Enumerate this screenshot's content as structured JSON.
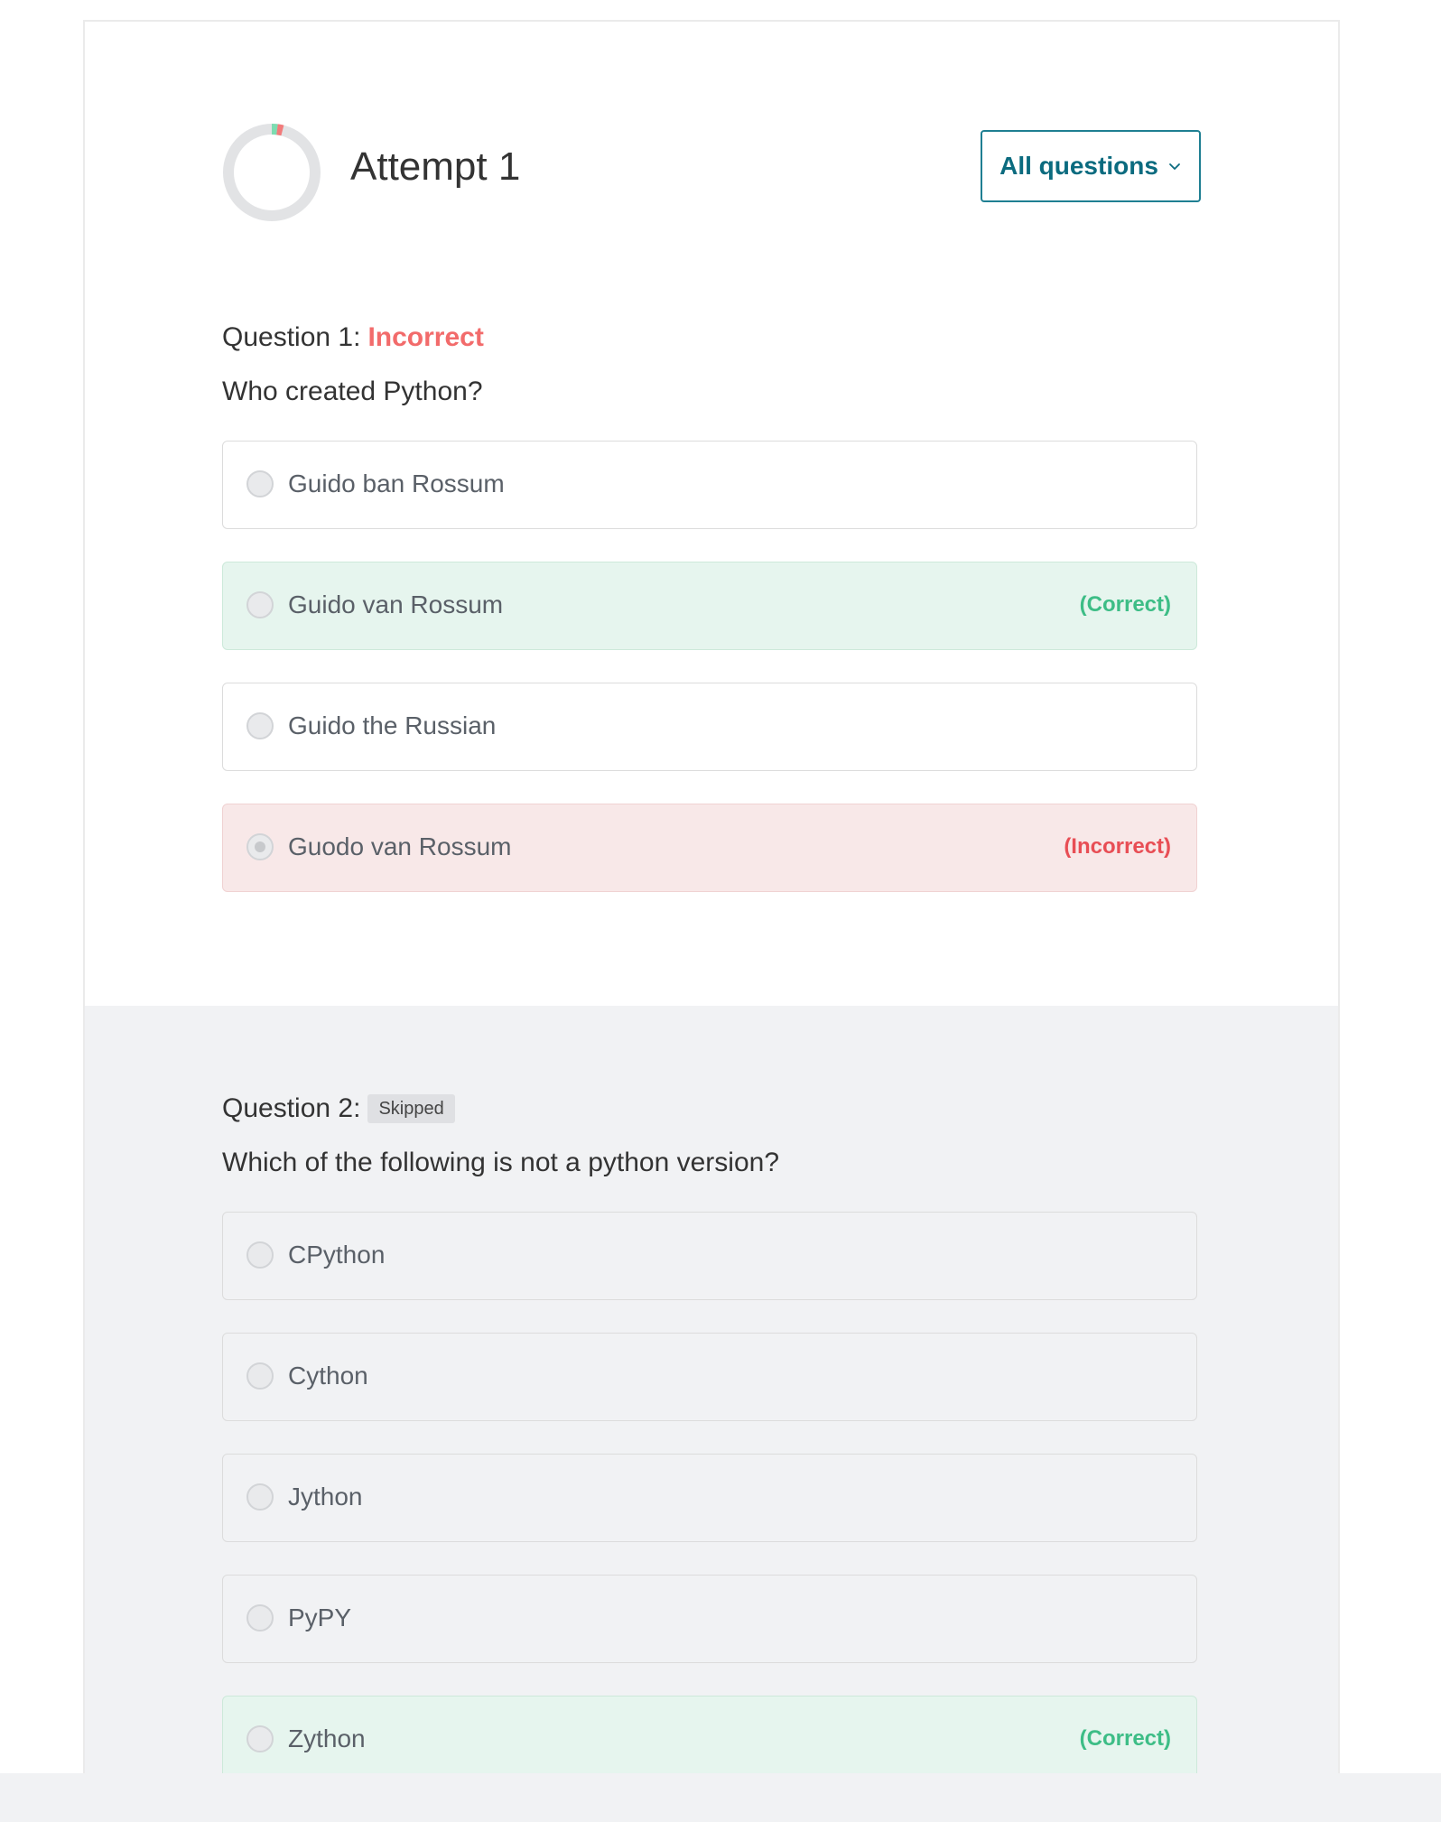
{
  "attempt": {
    "title": "Attempt 1",
    "all_questions_label": "All questions",
    "progress": {
      "correct_fraction": 0.02,
      "incorrect_fraction": 0.02,
      "correct_color": "#7ddcb1",
      "incorrect_color": "#f27b7b",
      "track_color": "#e2e3e5"
    }
  },
  "questions": [
    {
      "head": "Question 1:",
      "status": "Incorrect",
      "text": "Who created Python?",
      "options": [
        {
          "label": "Guido ban Rossum",
          "tag": ""
        },
        {
          "label": "Guido van Rossum",
          "tag": "(Correct)"
        },
        {
          "label": "Guido the Russian",
          "tag": ""
        },
        {
          "label": "Guodo van Rossum",
          "tag": "(Incorrect)"
        }
      ]
    },
    {
      "head": "Question 2:",
      "status": "Skipped",
      "text": "Which of the following is not a python version?",
      "options": [
        {
          "label": "CPython",
          "tag": ""
        },
        {
          "label": "Cython",
          "tag": ""
        },
        {
          "label": "Jython",
          "tag": ""
        },
        {
          "label": "PyPY",
          "tag": ""
        },
        {
          "label": "Zython",
          "tag": "(Correct)"
        }
      ]
    }
  ],
  "icons": {
    "dropdown": "chevron-down-icon",
    "progress": "progress-donut-icon"
  },
  "colors": {
    "accent": "#0b6b7f",
    "correct": "#3dbd86",
    "incorrect": "#e84e55"
  }
}
